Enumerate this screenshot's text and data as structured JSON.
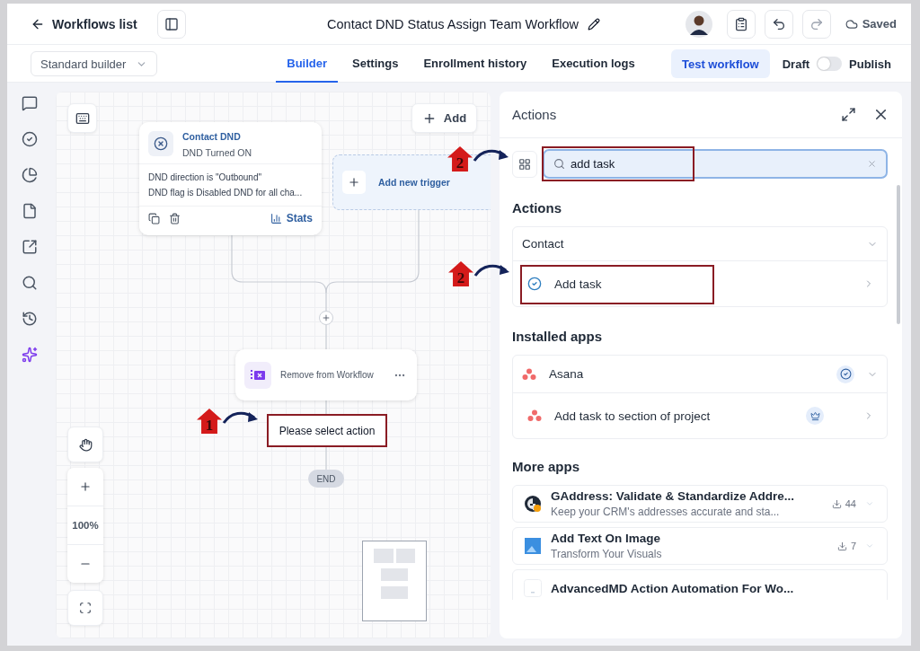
{
  "header": {
    "back_label": "Workflows list",
    "title": "Contact DND Status Assign Team Workflow",
    "save_status": "Saved"
  },
  "toolbar": {
    "builder_select": "Standard builder",
    "tabs": [
      {
        "label": "Builder",
        "selected": true
      },
      {
        "label": "Settings",
        "selected": false
      },
      {
        "label": "Enrollment history",
        "selected": false
      },
      {
        "label": "Execution logs",
        "selected": false
      }
    ],
    "test_button": "Test workflow",
    "draft_label": "Draft",
    "publish_toggle": {
      "on": false
    },
    "publish_label": "Publish"
  },
  "sidebar": [
    {
      "kind": "chat"
    },
    {
      "kind": "check"
    },
    {
      "kind": "pie"
    },
    {
      "kind": "file"
    },
    {
      "kind": "external"
    },
    {
      "kind": "search"
    },
    {
      "kind": "history"
    },
    {
      "kind": "sparkle"
    }
  ],
  "canvas": {
    "add_button": "Add",
    "trigger": {
      "title": "Contact DND",
      "subtitle": "DND Turned ON",
      "conditions": [
        "DND direction is \"Outbound\"",
        "DND flag is Disabled DND for all cha..."
      ],
      "stats": "Stats"
    },
    "new_trigger": "Add new trigger",
    "action": {
      "title": "Remove from Workflow"
    },
    "pending": {
      "label": "Please select action",
      "annotation": "1"
    },
    "end": "END",
    "zoom": "100%"
  },
  "panel": {
    "title": "Actions",
    "search": {
      "value": "add task",
      "annotation": "2"
    },
    "sections": [
      {
        "title": "Actions",
        "groups": [
          {
            "name": "Contact",
            "expanded": true,
            "connected": false,
            "items": [
              {
                "label": "Add task",
                "premium": false,
                "annotation": "2"
              }
            ]
          }
        ]
      },
      {
        "title": "Installed apps",
        "groups": [
          {
            "name": "Asana",
            "expanded": true,
            "connected": true,
            "items": [
              {
                "label": "Add task to section of project",
                "premium": true
              }
            ]
          }
        ]
      }
    ],
    "more_apps": {
      "title": "More apps",
      "apps": [
        {
          "kind": "gaddress",
          "name": "GAddress: Validate & Standardize Addre...",
          "description": "Keep your CRM's addresses accurate and sta...",
          "installs": "44"
        },
        {
          "kind": "image",
          "name": "Add Text On Image",
          "description": "Transform Your Visuals",
          "installs": "7"
        },
        {
          "kind": "blank",
          "name": "AdvancedMD Action Automation For Wo..."
        }
      ]
    }
  }
}
